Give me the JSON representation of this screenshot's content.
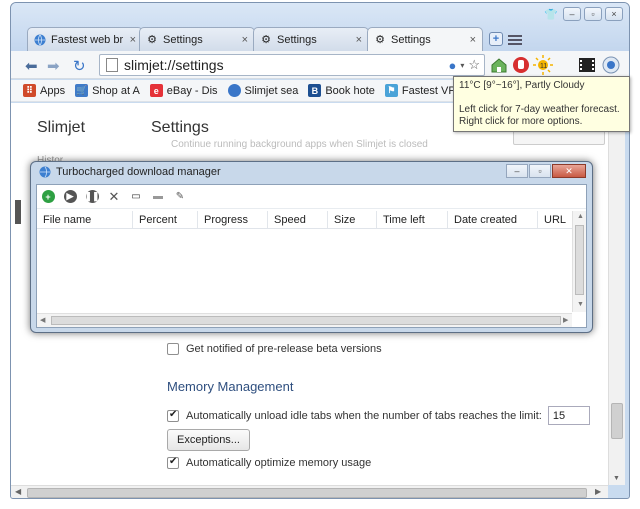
{
  "tabs": [
    {
      "label": "Fastest web br",
      "icon": "globe-icon",
      "active": false
    },
    {
      "label": "Settings",
      "icon": "gear-icon",
      "active": false
    },
    {
      "label": "Settings",
      "icon": "gear-icon",
      "active": false
    },
    {
      "label": "Settings",
      "icon": "gear-icon",
      "active": true
    }
  ],
  "toolbar": {
    "url": "slimjet://settings"
  },
  "bookmarks": [
    {
      "label": "Apps",
      "icon": "apps-grid-icon",
      "color": "#d04a2a"
    },
    {
      "label": "Shop at A",
      "icon": "cart-icon",
      "color": "#3f7bc8"
    },
    {
      "label": "eBay - Dis",
      "icon": "ebay-icon",
      "color": "#e53238"
    },
    {
      "label": "Slimjet sea",
      "icon": "globe-icon",
      "color": "#3a76c8"
    },
    {
      "label": "Book hote",
      "icon": "booking-icon",
      "color": "#1d4f91"
    },
    {
      "label": "Fastest VP",
      "icon": "vpn-icon",
      "color": "#4aa3d8"
    }
  ],
  "tooltip": {
    "line1": "11°C [9°~16°], Partly Cloudy",
    "line2": "Left click for 7-day weather forecast.",
    "line3": "Right click for more options."
  },
  "page": {
    "brand": "Slimjet",
    "title": "Settings",
    "sidebar_partial": "Histor",
    "faded_text": "Continue running background apps when Slimjet is closed",
    "beta_label": "Get notified of pre-release beta versions",
    "memory_section": "Memory Management",
    "unload_label": "Automatically unload idle tabs when the number of tabs reaches the limit:",
    "unload_limit": "15",
    "exceptions_label": "Exceptions...",
    "optimize_label": "Automatically optimize memory usage"
  },
  "download_manager": {
    "title": "Turbocharged download manager",
    "columns": [
      "File name",
      "Percent",
      "Progress",
      "Speed",
      "Size",
      "Time left",
      "Date created",
      "URL"
    ]
  },
  "colors": {
    "accent": "#2f4f7f",
    "frame": "#c9dbef"
  }
}
